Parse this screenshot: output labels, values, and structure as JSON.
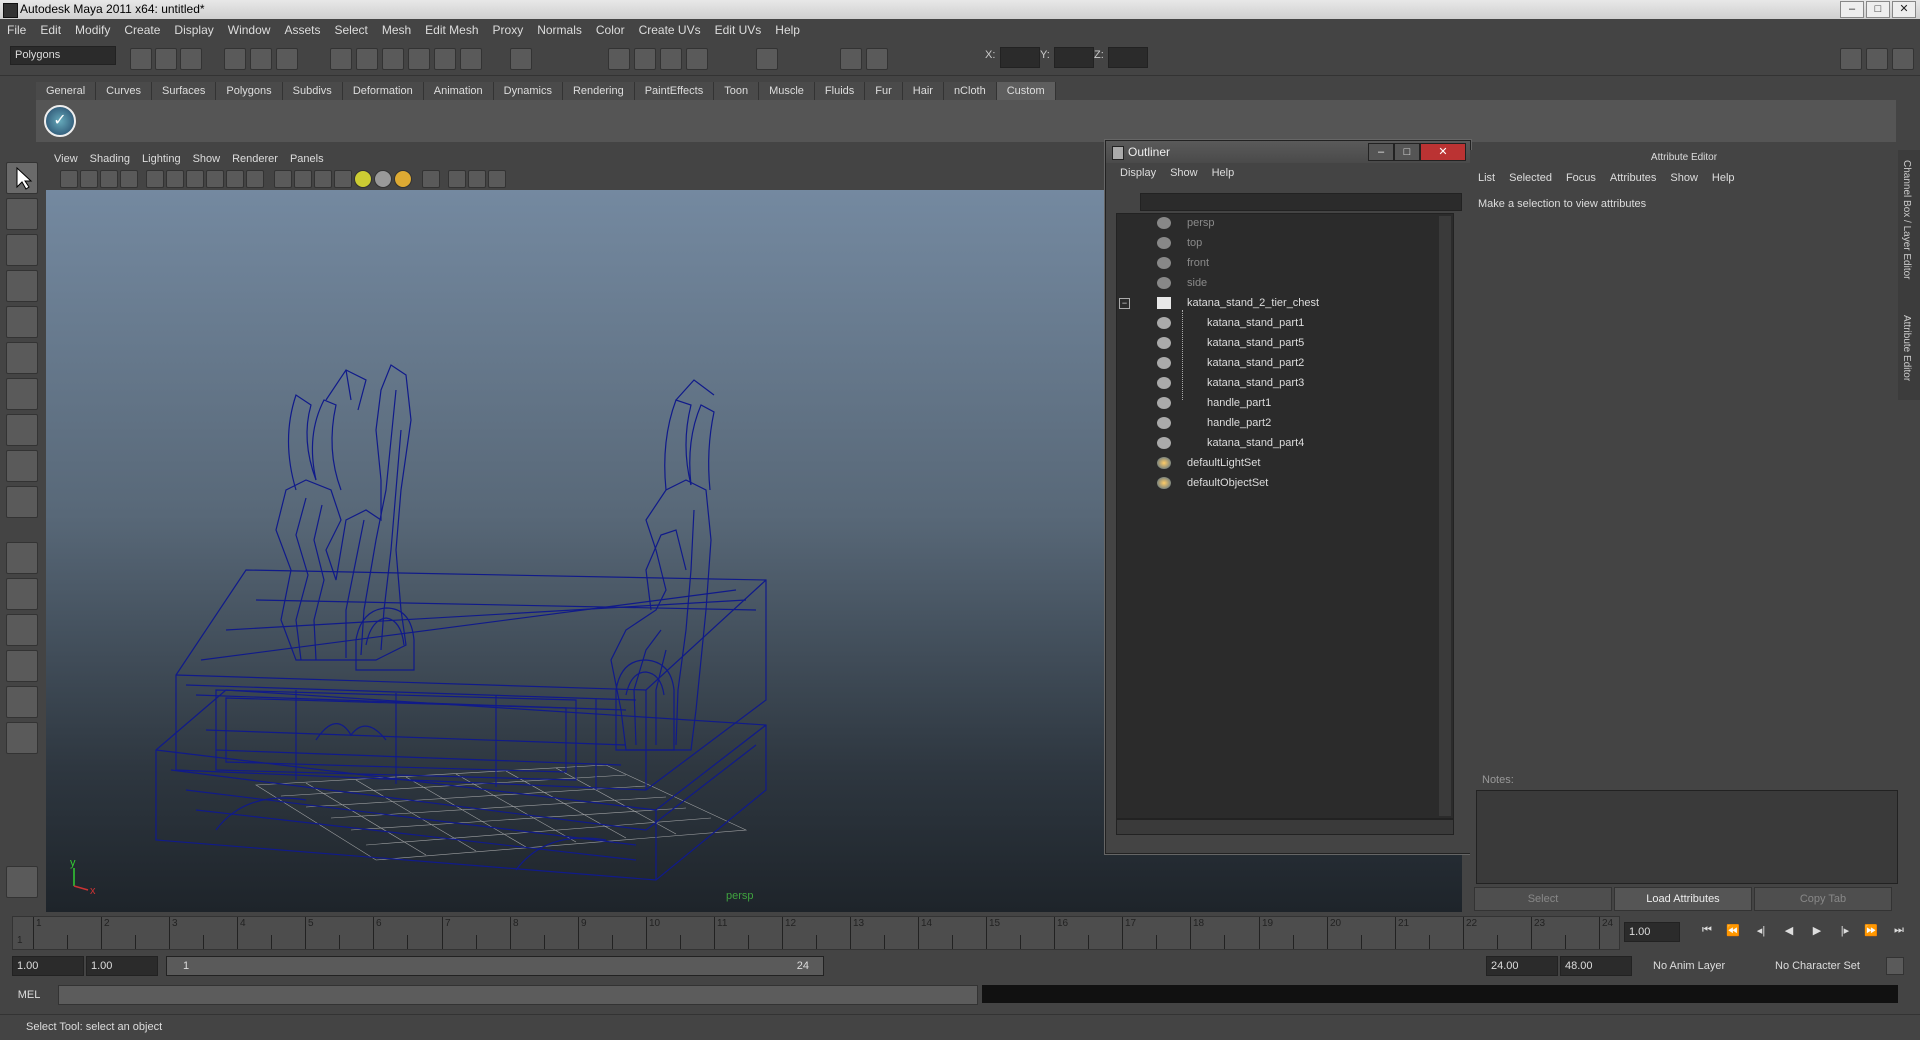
{
  "window": {
    "title": "Autodesk Maya 2011 x64: untitled*"
  },
  "menu": [
    "File",
    "Edit",
    "Modify",
    "Create",
    "Display",
    "Window",
    "Assets",
    "Select",
    "Mesh",
    "Edit Mesh",
    "Proxy",
    "Normals",
    "Color",
    "Create UVs",
    "Edit UVs",
    "Help"
  ],
  "statusline": {
    "mode": "Polygons",
    "x_label": "X:",
    "y_label": "Y:",
    "z_label": "Z:"
  },
  "shelf": {
    "tabs": [
      "General",
      "Curves",
      "Surfaces",
      "Polygons",
      "Subdivs",
      "Deformation",
      "Animation",
      "Dynamics",
      "Rendering",
      "PaintEffects",
      "Toon",
      "Muscle",
      "Fluids",
      "Fur",
      "Hair",
      "nCloth",
      "Custom"
    ],
    "active_tab": "Custom"
  },
  "viewport": {
    "menu": [
      "View",
      "Shading",
      "Lighting",
      "Show",
      "Renderer",
      "Panels"
    ],
    "camera": "persp",
    "axis_x": "x",
    "axis_y": "y",
    "wire_color": "#101a8a"
  },
  "outliner": {
    "title": "Outliner",
    "menu": [
      "Display",
      "Show",
      "Help"
    ],
    "items": [
      {
        "label": "persp",
        "dim": true,
        "type": "camera"
      },
      {
        "label": "top",
        "dim": true,
        "type": "camera"
      },
      {
        "label": "front",
        "dim": true,
        "type": "camera"
      },
      {
        "label": "side",
        "dim": true,
        "type": "camera"
      },
      {
        "label": "katana_stand_2_tier_chest",
        "dim": false,
        "type": "group"
      },
      {
        "label": "katana_stand_part1",
        "dim": false,
        "type": "mesh"
      },
      {
        "label": "katana_stand_part5",
        "dim": false,
        "type": "mesh"
      },
      {
        "label": "katana_stand_part2",
        "dim": false,
        "type": "mesh"
      },
      {
        "label": "katana_stand_part3",
        "dim": false,
        "type": "mesh"
      },
      {
        "label": "handle_part1",
        "dim": false,
        "type": "mesh"
      },
      {
        "label": "handle_part2",
        "dim": false,
        "type": "mesh"
      },
      {
        "label": "katana_stand_part4",
        "dim": false,
        "type": "mesh"
      },
      {
        "label": "defaultLightSet",
        "dim": false,
        "type": "set"
      },
      {
        "label": "defaultObjectSet",
        "dim": false,
        "type": "set"
      }
    ]
  },
  "attribute_editor": {
    "title": "Attribute Editor",
    "menu": [
      "List",
      "Selected",
      "Focus",
      "Attributes",
      "Show",
      "Help"
    ],
    "message": "Make a selection to view attributes",
    "notes_label": "Notes:",
    "buttons": {
      "select": "Select",
      "load": "Load Attributes",
      "copy": "Copy Tab"
    },
    "side_tabs": [
      "Channel Box / Layer Editor",
      "Attribute Editor"
    ]
  },
  "timeline": {
    "ticks": [
      "1",
      "2",
      "3",
      "4",
      "5",
      "6",
      "7",
      "8",
      "9",
      "10",
      "11",
      "12",
      "13",
      "14",
      "15",
      "16",
      "17",
      "18",
      "19",
      "20",
      "21",
      "22",
      "23",
      "24"
    ],
    "current_frame_marker": "1",
    "current_frame": "1.00"
  },
  "range": {
    "start": "1.00",
    "start2": "1.00",
    "slider_start": "1",
    "slider_end": "24",
    "end": "24.00",
    "end2": "48.00",
    "anim_layer": "No Anim Layer",
    "char_set": "No Character Set"
  },
  "command": {
    "mel_label": "MEL"
  },
  "helpline": {
    "text": "Select Tool: select an object"
  }
}
